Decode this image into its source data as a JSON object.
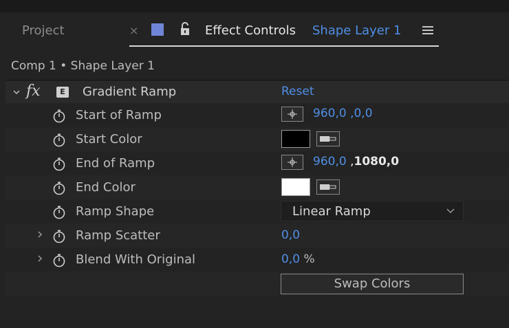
{
  "tabs": {
    "project_label": "Project",
    "close_glyph": "×",
    "effect_controls_label": "Effect Controls",
    "layer_name": "Shape Layer 1",
    "layer_color": "#6f86d6"
  },
  "breadcrumb": "Comp 1 • Shape Layer 1",
  "effect": {
    "fx_label": "fx",
    "name": "Gradient Ramp",
    "reset_label": "Reset"
  },
  "properties": [
    {
      "label": "Start of Ramp",
      "x": "960,0",
      "sep": " ,",
      "y": "0,0"
    },
    {
      "label": "Start Color",
      "color": "#000000"
    },
    {
      "label": "End of Ramp",
      "x": "960,0",
      "sep": " ,",
      "y": "1080,0"
    },
    {
      "label": "End Color",
      "color": "#ffffff"
    },
    {
      "label": "Ramp Shape",
      "selected": "Linear Ramp"
    },
    {
      "label": "Ramp Scatter",
      "value": "0,0"
    },
    {
      "label": "Blend With Original",
      "value": "0,0",
      "unit": "%"
    }
  ],
  "swap_button": "Swap Colors",
  "colors": {
    "accent_blue": "#4f8fe6",
    "panel_bg": "#232323"
  }
}
